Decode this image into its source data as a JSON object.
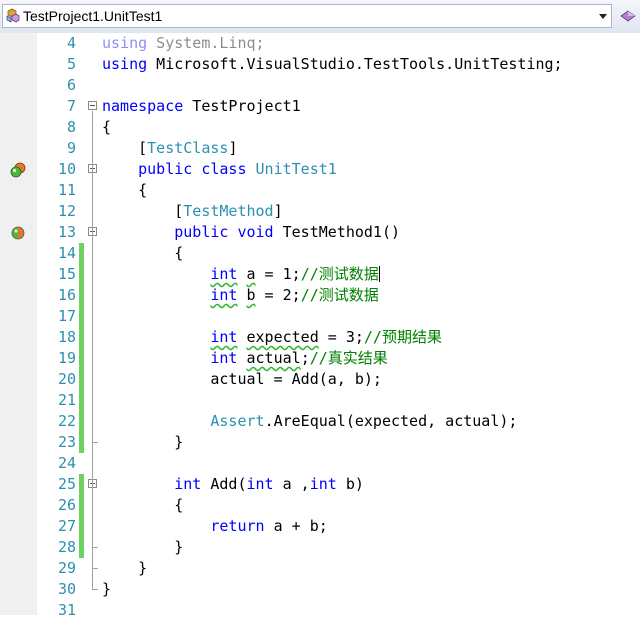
{
  "nav": {
    "type_combo": "TestProject1.UnitTest1",
    "type_icon": "class-icon",
    "member_icon": "method-icon"
  },
  "colors": {
    "keyword": "#0000ff",
    "type": "#2b91af",
    "comment": "#008000",
    "line_number": "#2b91af",
    "changed_bar": "#6ad45e"
  },
  "lines": [
    {
      "n": "4",
      "t": [
        [
          "using",
          "kw"
        ],
        [
          " System.Linq;",
          ""
        ]
      ],
      "dim": true
    },
    {
      "n": "5",
      "t": [
        [
          "using",
          "kw"
        ],
        [
          " Microsoft.VisualStudio.TestTools.UnitTesting;",
          ""
        ]
      ]
    },
    {
      "n": "6",
      "t": []
    },
    {
      "n": "7",
      "t": [
        [
          "namespace",
          "kw"
        ],
        [
          " TestProject1",
          ""
        ]
      ]
    },
    {
      "n": "8",
      "t": [
        [
          "{",
          ""
        ]
      ]
    },
    {
      "n": "9",
      "t": [
        [
          "    [",
          ""
        ],
        [
          "TestClass",
          "ty"
        ],
        [
          "]",
          ""
        ]
      ]
    },
    {
      "n": "10",
      "t": [
        [
          "    ",
          ""
        ],
        [
          "public",
          "kw"
        ],
        [
          " ",
          ""
        ],
        [
          "class",
          "kw"
        ],
        [
          " ",
          ""
        ],
        [
          "UnitTest1",
          "ty"
        ]
      ]
    },
    {
      "n": "11",
      "t": [
        [
          "    {",
          ""
        ]
      ]
    },
    {
      "n": "12",
      "t": [
        [
          "        [",
          ""
        ],
        [
          "TestMethod",
          "ty"
        ],
        [
          "]",
          ""
        ]
      ]
    },
    {
      "n": "13",
      "t": [
        [
          "        ",
          ""
        ],
        [
          "public",
          "kw"
        ],
        [
          " ",
          ""
        ],
        [
          "void",
          "kw"
        ],
        [
          " TestMethod1()",
          ""
        ]
      ]
    },
    {
      "n": "14",
      "t": [
        [
          "        {",
          ""
        ]
      ]
    },
    {
      "n": "15",
      "t": [
        [
          "            ",
          ""
        ],
        [
          "int",
          "kw sq"
        ],
        [
          " ",
          ""
        ],
        [
          "a",
          "sq"
        ],
        [
          " = 1;",
          ""
        ],
        [
          "//测试数据",
          "cm"
        ],
        [
          "",
          "caret"
        ]
      ]
    },
    {
      "n": "16",
      "t": [
        [
          "            ",
          ""
        ],
        [
          "int",
          "kw sq"
        ],
        [
          " ",
          ""
        ],
        [
          "b",
          "sq"
        ],
        [
          " = 2;",
          ""
        ],
        [
          "//测试数据",
          "cm"
        ]
      ]
    },
    {
      "n": "17",
      "t": []
    },
    {
      "n": "18",
      "t": [
        [
          "            ",
          ""
        ],
        [
          "int",
          "kw sq"
        ],
        [
          " ",
          ""
        ],
        [
          "expected",
          "sq"
        ],
        [
          " = 3;",
          ""
        ],
        [
          "//预期结果",
          "cm"
        ]
      ]
    },
    {
      "n": "19",
      "t": [
        [
          "            ",
          ""
        ],
        [
          "int",
          "kw"
        ],
        [
          " ",
          ""
        ],
        [
          "actual",
          "sq"
        ],
        [
          ";",
          ""
        ],
        [
          "//真实结果",
          "cm"
        ]
      ]
    },
    {
      "n": "20",
      "t": [
        [
          "            actual = Add(a, b);",
          ""
        ]
      ]
    },
    {
      "n": "21",
      "t": []
    },
    {
      "n": "22",
      "t": [
        [
          "            ",
          ""
        ],
        [
          "Assert",
          "ty"
        ],
        [
          ".AreEqual(expected, actual);",
          ""
        ]
      ]
    },
    {
      "n": "23",
      "t": [
        [
          "        }",
          ""
        ]
      ]
    },
    {
      "n": "24",
      "t": []
    },
    {
      "n": "25",
      "t": [
        [
          "        ",
          ""
        ],
        [
          "int",
          "kw"
        ],
        [
          " Add(",
          ""
        ],
        [
          "int",
          "kw"
        ],
        [
          " a ,",
          ""
        ],
        [
          "int",
          "kw"
        ],
        [
          " b)",
          ""
        ]
      ]
    },
    {
      "n": "26",
      "t": [
        [
          "        {",
          ""
        ]
      ]
    },
    {
      "n": "27",
      "t": [
        [
          "            ",
          ""
        ],
        [
          "return",
          "kw"
        ],
        [
          " a + b;",
          ""
        ]
      ]
    },
    {
      "n": "28",
      "t": [
        [
          "        }",
          ""
        ]
      ]
    },
    {
      "n": "29",
      "t": [
        [
          "    }",
          ""
        ]
      ]
    },
    {
      "n": "30",
      "t": [
        [
          "}",
          ""
        ]
      ]
    },
    {
      "n": "31",
      "t": []
    }
  ]
}
